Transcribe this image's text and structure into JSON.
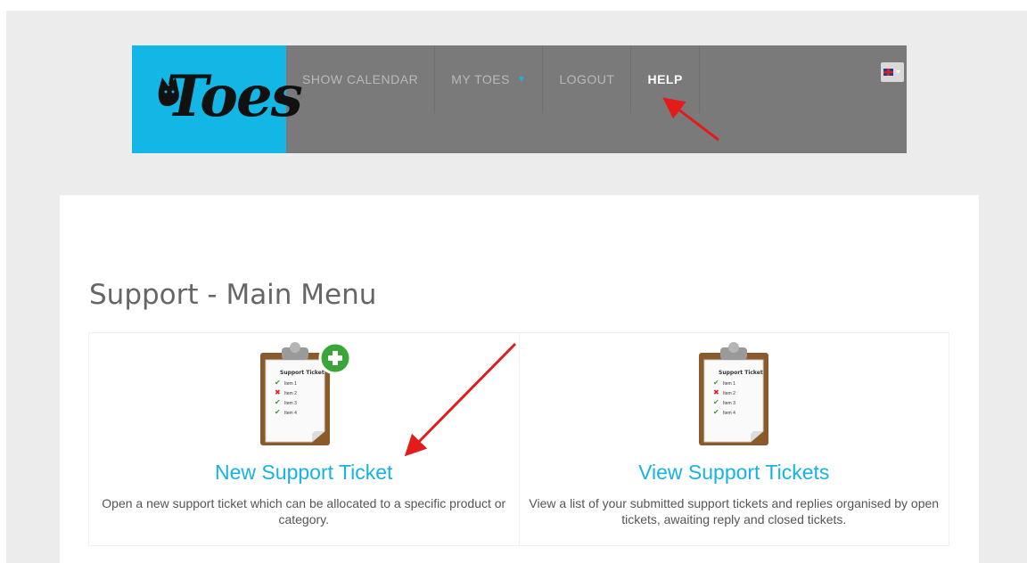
{
  "header": {
    "logo_text": "Toes",
    "nav": [
      {
        "label": "SHOW CALENDAR"
      },
      {
        "label": "MY TOES"
      },
      {
        "label": "LOGOUT"
      },
      {
        "label": "HELP"
      }
    ],
    "language": "en-GB"
  },
  "page": {
    "title": "Support - Main Menu"
  },
  "options": [
    {
      "title": "New Support Ticket",
      "description": "Open a new support ticket which can be allocated to a specific product or category."
    },
    {
      "title": "View Support Tickets",
      "description": "View a list of your submitted support tickets and replies organised by open tickets, awaiting reply and closed tickets."
    }
  ],
  "clipboard": {
    "heading": "Support Ticket",
    "items": [
      "Item 1",
      "Item 2",
      "Item 3",
      "Item 4"
    ]
  },
  "colors": {
    "brand": "#13b7e6",
    "nav_bg": "#7a7a7a",
    "annotation_arrow": "#e31b1b"
  }
}
